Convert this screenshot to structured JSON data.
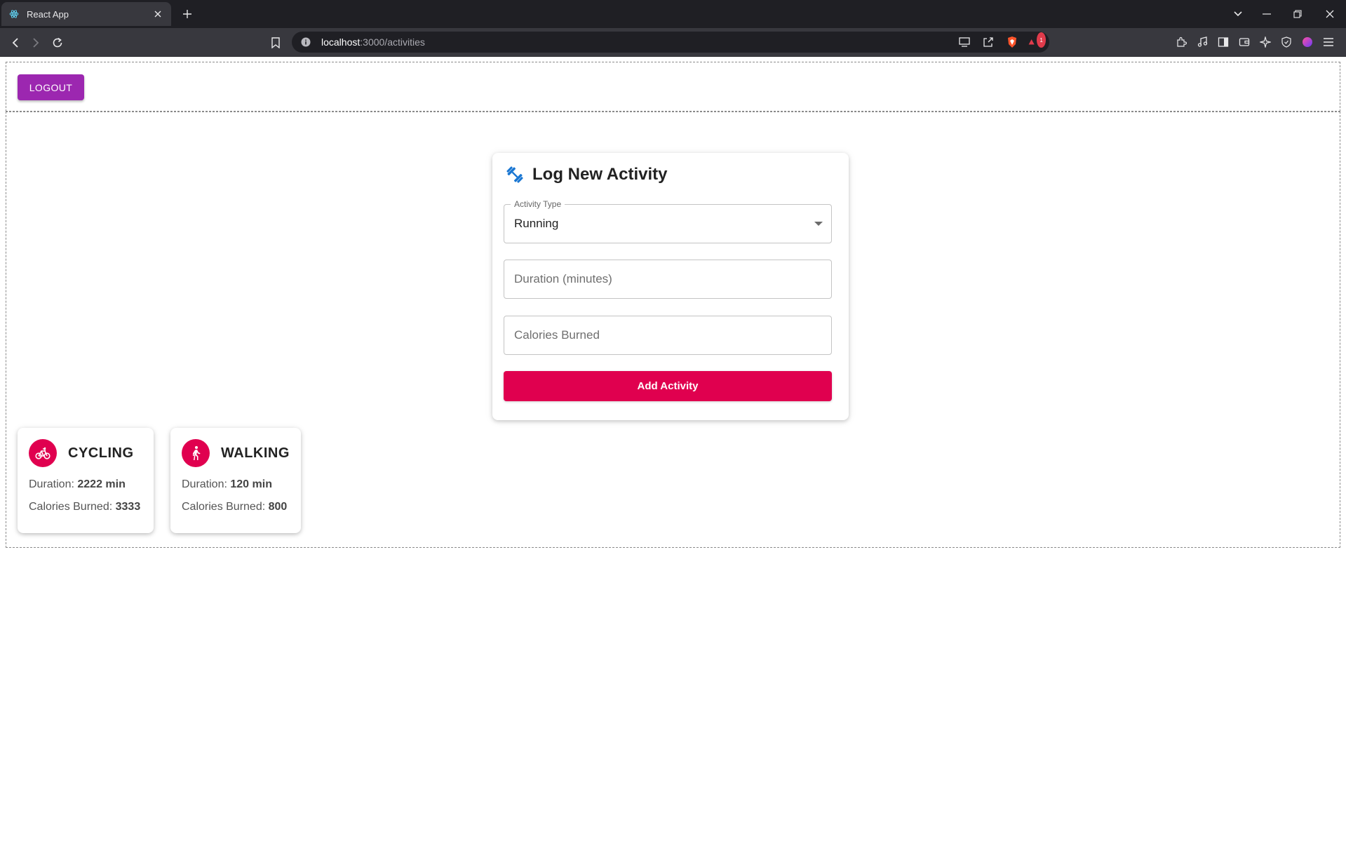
{
  "browser": {
    "tab_title": "React App",
    "url_host": "localhost",
    "url_path": ":3000/activities",
    "notification_count": "1"
  },
  "header": {
    "logout_label": "LOGOUT"
  },
  "form": {
    "title": "Log New Activity",
    "activity_type_label": "Activity Type",
    "activity_type_value": "Running",
    "duration_placeholder": "Duration (minutes)",
    "calories_placeholder": "Calories Burned",
    "submit_label": "Add Activity"
  },
  "activities": [
    {
      "type": "CYCLING",
      "icon": "bike-icon",
      "duration_label": "Duration:",
      "duration_value": "2222 min",
      "calories_label": "Calories Burned:",
      "calories_value": "3333"
    },
    {
      "type": "WALKING",
      "icon": "walk-icon",
      "duration_label": "Duration:",
      "duration_value": "120 min",
      "calories_label": "Calories Burned:",
      "calories_value": "800"
    }
  ],
  "colors": {
    "logout": "#9c27b0",
    "primary": "#e0004f",
    "dumbbell": "#1976d2"
  }
}
